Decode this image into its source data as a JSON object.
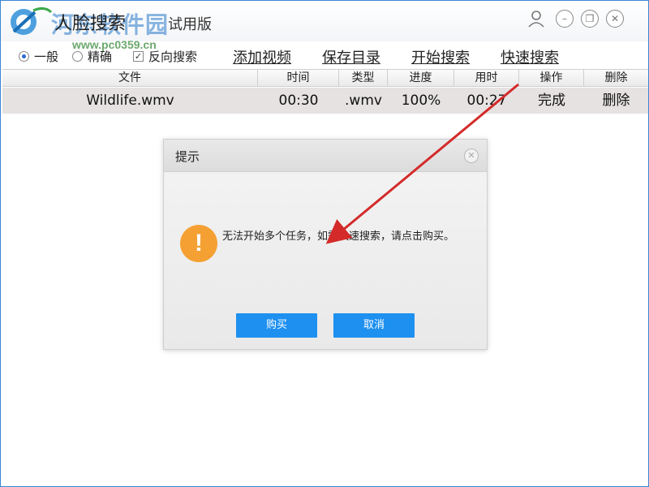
{
  "window": {
    "title": "人脸搜索",
    "edition": "试用版",
    "watermark": "河东软件园",
    "watermark_url": "www.pc0359.cn"
  },
  "icons": {
    "user": "user-icon",
    "minimize": "minimize-icon",
    "restore": "restore-icon",
    "close": "close-icon",
    "warning": "exclamation-icon"
  },
  "toolbar": {
    "mode_general": "一般",
    "mode_precise": "精确",
    "reverse_search": "反向搜索",
    "selected_mode": "一般",
    "reverse_checked": true,
    "add_video": "添加视频",
    "save_dir": "保存目录",
    "start_search": "开始搜索",
    "fast_search": "快速搜索"
  },
  "table": {
    "columns": [
      "文件",
      "时间",
      "类型",
      "进度",
      "用时",
      "操作",
      "删除"
    ],
    "rows": [
      {
        "file": "Wildlife.wmv",
        "time": "00:30",
        "type": ".wmv",
        "progress": "100%",
        "elapsed": "00:27",
        "action": "完成",
        "delete": "删除"
      }
    ]
  },
  "dialog": {
    "title": "提示",
    "message": "无法开始多个任务，如需快速搜索，请点击购买。",
    "buy_label": "购买",
    "cancel_label": "取消"
  },
  "colors": {
    "window_border": "#3c86d4",
    "button_blue": "#1e90f0",
    "warning_orange": "#f5a033",
    "arrow_red": "#d42a2a",
    "row_bg": "#e6e2e2"
  }
}
